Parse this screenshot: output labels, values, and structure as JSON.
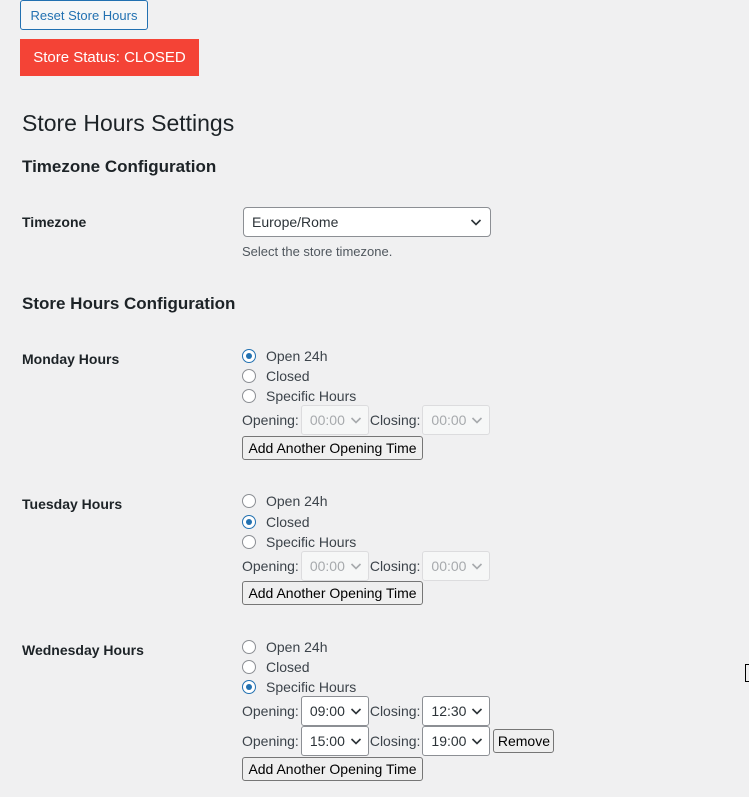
{
  "toolbar": {
    "reset_label": "Reset Store Hours"
  },
  "status": {
    "text": "Store Status: CLOSED",
    "color": "#f44336"
  },
  "page": {
    "title": "Store Hours Settings"
  },
  "timezone": {
    "section_title": "Timezone Configuration",
    "label": "Timezone",
    "selected": "Europe/Rome",
    "description": "Select the store timezone."
  },
  "hours": {
    "section_title": "Store Hours Configuration",
    "option_labels": [
      "Open 24h",
      "Closed",
      "Specific Hours"
    ],
    "opening_label": "Opening:",
    "closing_label": "Closing:",
    "add_label": "Add Another Opening Time",
    "remove_label": "Remove",
    "days": [
      {
        "label": "Monday Hours",
        "selected": "Open 24h",
        "slots": [
          {
            "open": "00:00",
            "close": "00:00"
          }
        ]
      },
      {
        "label": "Tuesday Hours",
        "selected": "Closed",
        "slots": [
          {
            "open": "00:00",
            "close": "00:00"
          }
        ]
      },
      {
        "label": "Wednesday Hours",
        "selected": "Specific Hours",
        "slots": [
          {
            "open": "09:00",
            "close": "12:30"
          },
          {
            "open": "15:00",
            "close": "19:00"
          }
        ]
      }
    ]
  }
}
